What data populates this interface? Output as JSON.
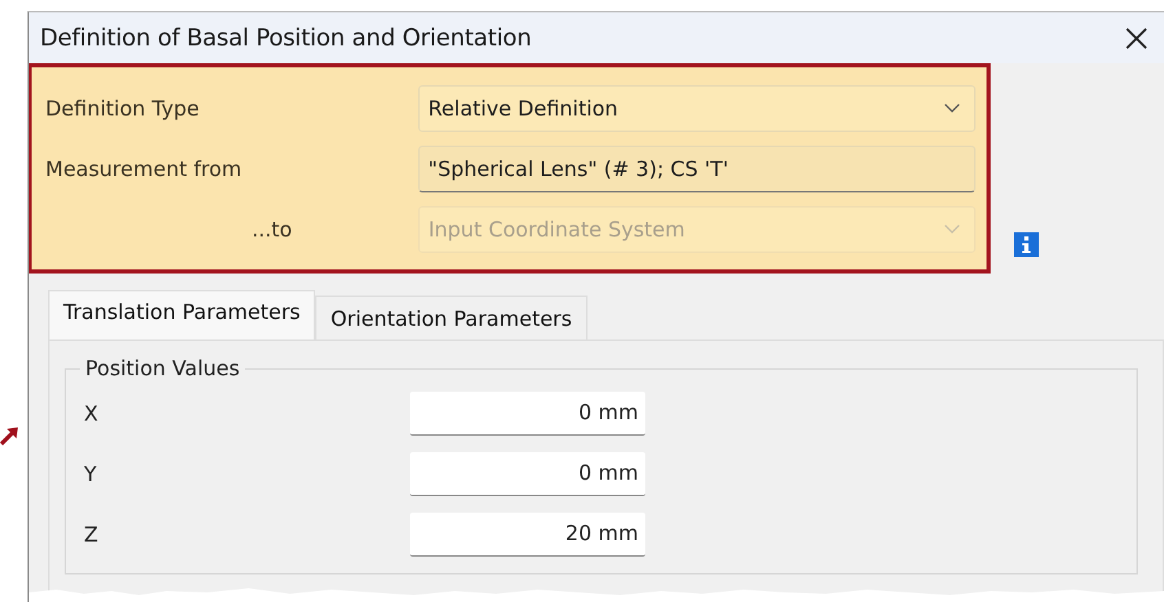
{
  "window": {
    "title": "Definition of Basal Position and Orientation"
  },
  "definition": [
    {
      "label": "Definition Type",
      "kind": "select",
      "value": "Relative Definition",
      "disabled": false
    },
    {
      "label": "Measurement from",
      "kind": "field",
      "value": "\"Spherical Lens\" (# 3); CS 'T'",
      "disabled": false
    },
    {
      "label": "...to",
      "kind": "select",
      "value": "Input Coordinate System",
      "disabled": true
    }
  ],
  "tabs": [
    {
      "label": "Translation Parameters",
      "selected": true
    },
    {
      "label": "Orientation Parameters",
      "selected": false
    }
  ],
  "position_values": {
    "title": "Position Values",
    "rows": [
      {
        "label": "X",
        "value": "0 mm"
      },
      {
        "label": "Y",
        "value": "0 mm"
      },
      {
        "label": "Z",
        "value": "20 mm"
      }
    ]
  }
}
